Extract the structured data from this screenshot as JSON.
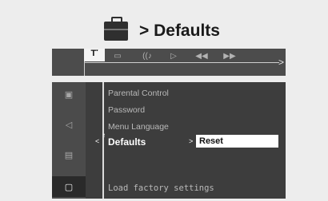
{
  "header": {
    "title": "> Defaults",
    "icon": "briefcase-icon"
  },
  "toolbar": {
    "items": [
      {
        "icon": "tools-icon",
        "label": "T་"
      },
      {
        "icon": "subtitle-icon",
        "label": "▭"
      },
      {
        "icon": "audio-icon",
        "label": "((♪"
      },
      {
        "icon": "play-icon",
        "label": "▷"
      },
      {
        "icon": "rewind-icon",
        "label": "◀◀"
      },
      {
        "icon": "fast-forward-icon",
        "label": "▶▶"
      }
    ]
  },
  "sidebar": {
    "items": [
      {
        "icon": "picture-icon",
        "label": "▣"
      },
      {
        "icon": "speaker-icon",
        "label": "◁"
      },
      {
        "icon": "chat-icon",
        "label": "▤"
      },
      {
        "icon": "briefcase-icon",
        "label": "▢"
      }
    ]
  },
  "menu": {
    "items": [
      "Parental Control",
      "Password",
      "Menu Language",
      "Defaults",
      "Load factory settings"
    ],
    "active_index": 3
  },
  "submenu": {
    "value": "Reset"
  },
  "colors": {
    "panel": "#3d3d3d",
    "background": "#ededed",
    "highlight": "#ffffff"
  }
}
